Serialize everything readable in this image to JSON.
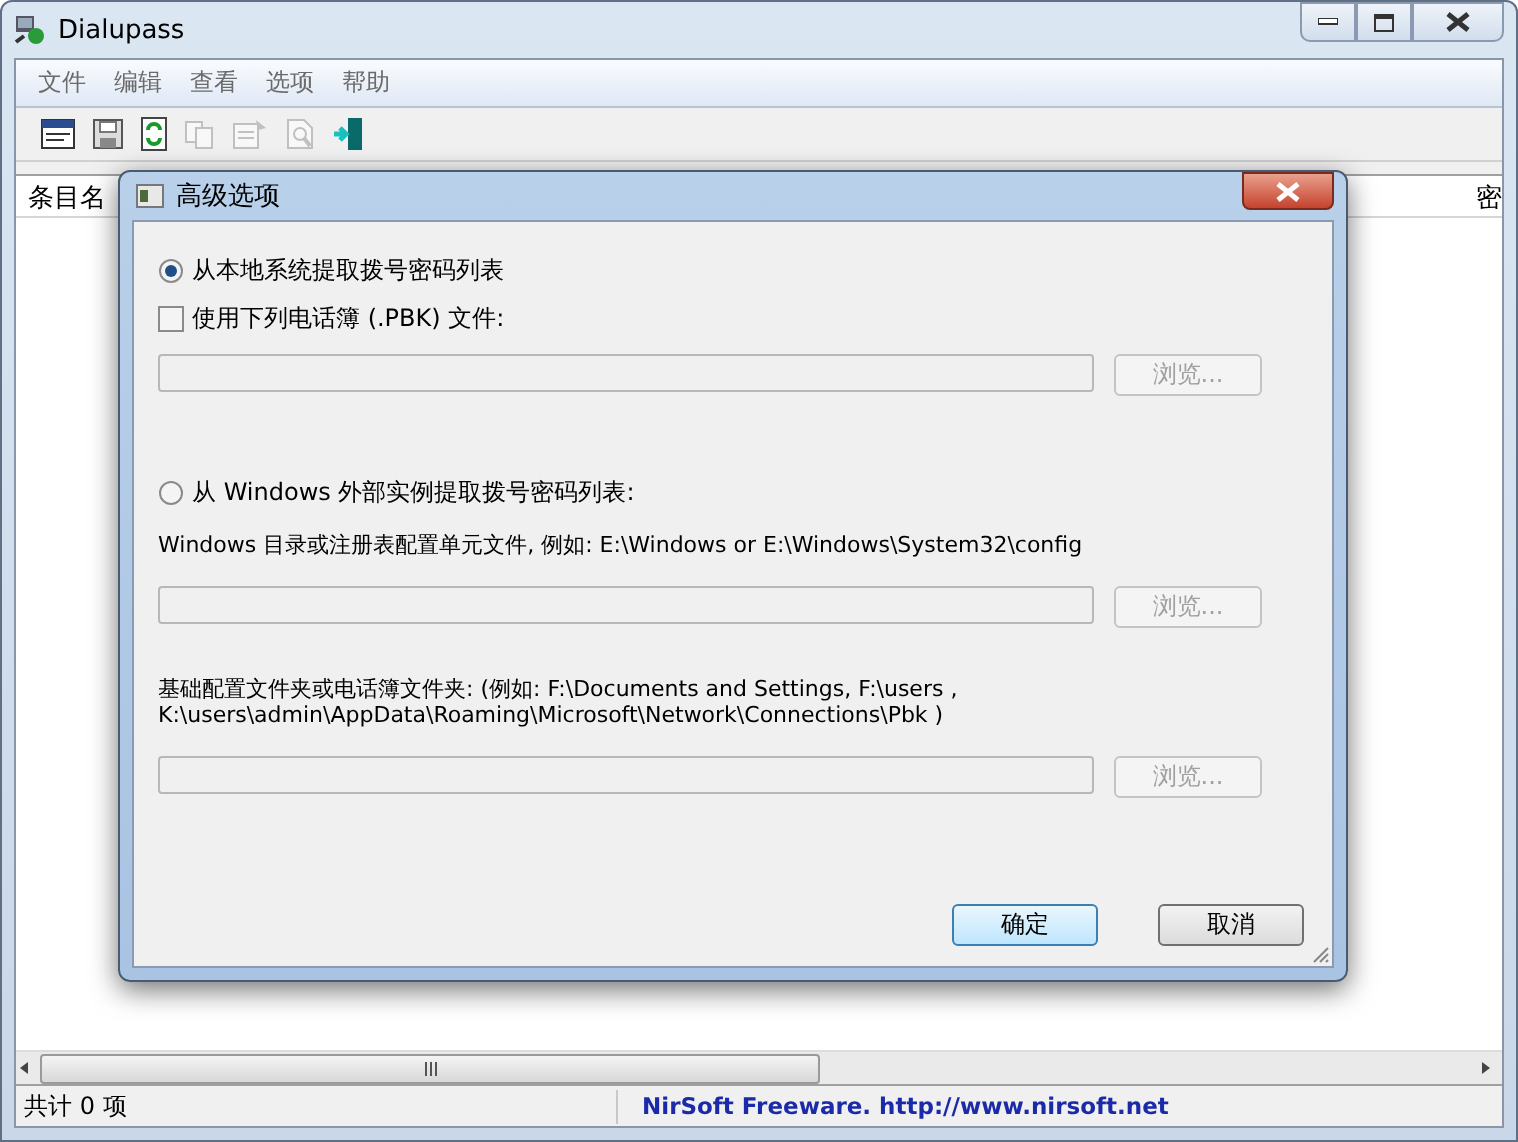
{
  "window": {
    "title": "Dialupass"
  },
  "menu": [
    "文件",
    "编辑",
    "查看",
    "选项",
    "帮助"
  ],
  "toolbar": [
    {
      "kind": "window",
      "disabled": false
    },
    {
      "kind": "save",
      "disabled": false
    },
    {
      "kind": "refresh",
      "disabled": false
    },
    {
      "kind": "copy",
      "disabled": true
    },
    {
      "kind": "properties",
      "disabled": true
    },
    {
      "kind": "find",
      "disabled": true
    },
    {
      "kind": "exit",
      "disabled": false
    }
  ],
  "list": {
    "columns": [
      "条目名",
      "密"
    ]
  },
  "dialog": {
    "title": "高级选项",
    "options": [
      {
        "kind": "radio",
        "label": "从本地系统提取拨号密码列表",
        "selected": true
      },
      {
        "kind": "checkbox",
        "label": "使用下列电话簿 (.PBK) 文件:",
        "checked": false
      },
      {
        "kind": "path",
        "disabled": true,
        "button": "浏览..."
      },
      {
        "kind": "spacer"
      },
      {
        "kind": "radio",
        "label": "从 Windows 外部实例提取拨号密码列表:",
        "selected": false
      },
      {
        "kind": "note",
        "lines": [
          "Windows 目录或注册表配置单元文件, 例如:  E:\\Windows or E:\\Windows\\System32\\config"
        ]
      },
      {
        "kind": "path",
        "disabled": true,
        "button": "浏览..."
      },
      {
        "kind": "note",
        "lines": [
          "基础配置文件夹或电话簿文件夹: (例如:  F:\\Documents and Settings, F:\\users ,",
          "K:\\users\\admin\\AppData\\Roaming\\Microsoft\\Network\\Connections\\Pbk  )"
        ]
      },
      {
        "kind": "path",
        "disabled": true,
        "button": "浏览..."
      }
    ],
    "buttons": [
      {
        "label": "确定",
        "default": true
      },
      {
        "label": "取消",
        "default": false
      }
    ]
  },
  "status_bar": {
    "count": "共计 0 项",
    "link": "NirSoft Freeware.  http://www.nirsoft.net"
  }
}
